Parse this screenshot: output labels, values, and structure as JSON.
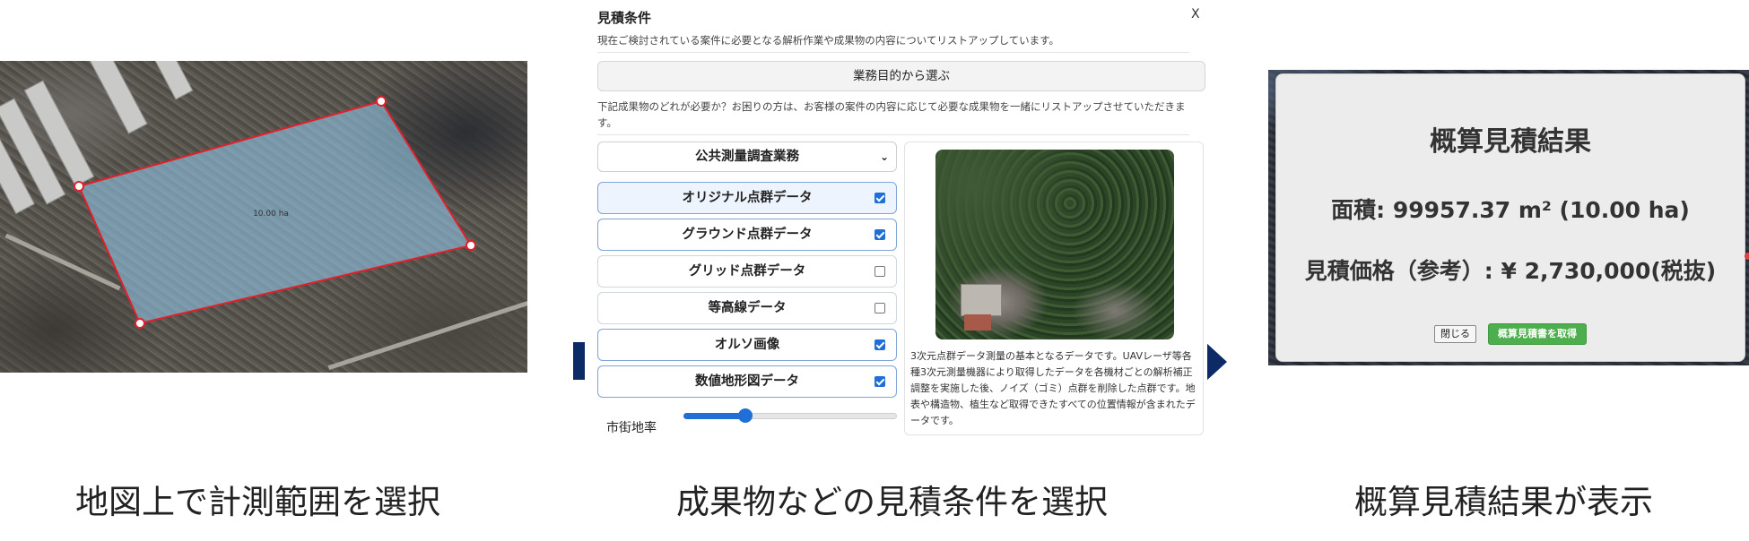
{
  "map": {
    "area_label": "10.00 ha"
  },
  "form": {
    "title": "見積条件",
    "close_label": "X",
    "description": "現在ご検討されている案件に必要となる解析作業や成果物の内容についてリストアップしています。",
    "purpose_button": "業務目的から選ぶ",
    "help_text": "下記成果物のどれが必要か？お困りの方は、お客様の案件の内容に応じて必要な成果物を一緒にリストアップさせていただきます。",
    "category_select": {
      "selected": "公共測量調査業務"
    },
    "options": [
      {
        "label": "オリジナル点群データ",
        "checked": true
      },
      {
        "label": "グラウンド点群データ",
        "checked": true
      },
      {
        "label": "グリッド点群データ",
        "checked": false
      },
      {
        "label": "等高線データ",
        "checked": false
      },
      {
        "label": "オルソ画像",
        "checked": true
      },
      {
        "label": "数値地形図データ",
        "checked": true
      }
    ],
    "slider": {
      "label": "市街地率",
      "value_fraction": 0.29
    },
    "detail_text": "3次元点群データ測量の基本となるデータです。UAVレーザ等各種3次元測量機器により取得したデータを各機材ごとの解析補正調整を実施した後、ノイズ（ゴミ）点群を削除した点群です。地表や構造物、植生など取得できたすべての位置情報が含まれたデータです。"
  },
  "result": {
    "title": "概算見積結果",
    "area_text": "面積: 99957.37 m² (10.00 ha)",
    "price_text": "見積価格（参考）: ¥ 2,730,000(税抜)",
    "close_button": "閉じる",
    "get_button": "概算見積書を取得"
  },
  "captions": {
    "step1": "地図上で計測範囲を選択",
    "step2": "成果物などの見積条件を選択",
    "step3": "概算見積結果が表示"
  },
  "colors": {
    "accent_blue": "#1f6fd6",
    "navy_arrow": "#0c2b66",
    "polygon_stroke": "#e2202a",
    "polygon_fill": "#8ec1e0",
    "green_button": "#4cae4c"
  }
}
